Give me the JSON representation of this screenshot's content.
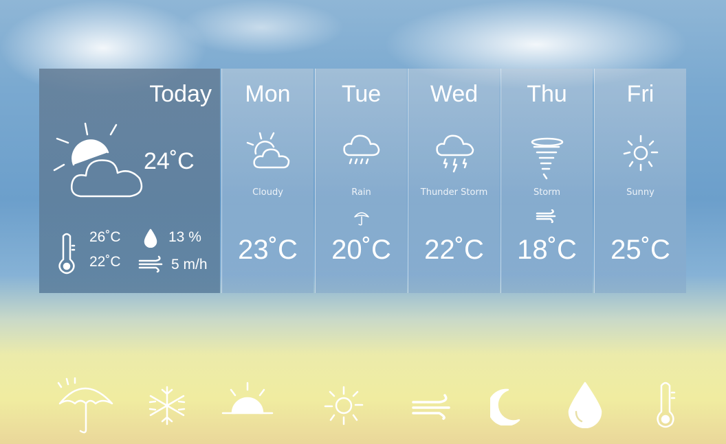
{
  "today": {
    "label": "Today",
    "temp": "24˚C",
    "high": "26˚C",
    "low": "22˚C",
    "humidity": "13 %",
    "wind": "5 m/h",
    "icon": "partly-cloudy-icon"
  },
  "days": [
    {
      "label": "Mon",
      "condition": "Cloudy",
      "temp": "23˚C",
      "icon": "partly-cloudy-icon"
    },
    {
      "label": "Tue",
      "condition": "Rain",
      "temp": "20˚C",
      "icon": "rain-cloud-icon",
      "extra_icon": "umbrella-icon"
    },
    {
      "label": "Wed",
      "condition": "Thunder Storm",
      "temp": "22˚C",
      "icon": "thunderstorm-icon"
    },
    {
      "label": "Thu",
      "condition": "Storm",
      "temp": "18˚C",
      "icon": "tornado-icon",
      "extra_icon": "wind-icon"
    },
    {
      "label": "Fri",
      "condition": "Sunny",
      "temp": "25˚C",
      "icon": "sun-icon"
    }
  ],
  "bottom_icons": [
    "umbrella-icon",
    "snowflake-icon",
    "sunrise-icon",
    "sun-icon",
    "wind-icon",
    "moon-icon",
    "drop-icon",
    "thermometer-icon"
  ]
}
